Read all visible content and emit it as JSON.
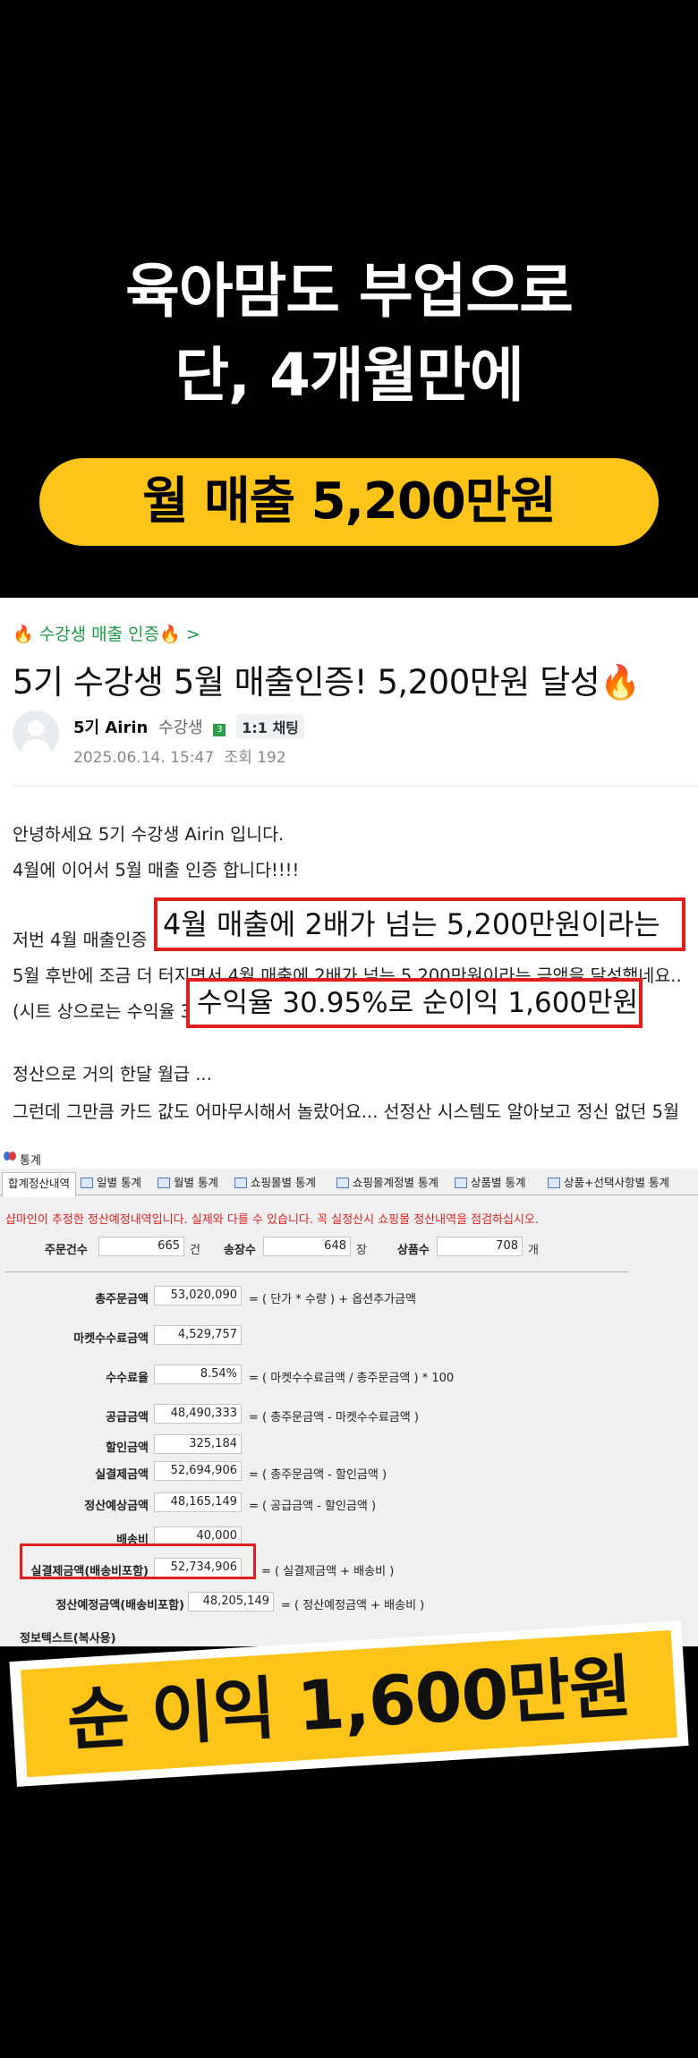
{
  "hero": {
    "line1": "육아맘도 부업으로",
    "line2": "단, 4개월만에",
    "highlight": "월 매출 5,200만원",
    "pill_color": "#fcc419"
  },
  "post": {
    "cafe_link": "🔥 수강생 매출 인증🔥 >",
    "title": "5기 수강생 5월 매출인증! 5,200만원 달성🔥",
    "author": "5기 Airin",
    "role": "수강생",
    "level": "3",
    "chat_label": "1:1 채팅",
    "date": "2025.06.14. 15:47",
    "views": "조회 192",
    "body": [
      "안녕하세요 5기 수강생 Airin 입니다.",
      "4월에 이어서 5월 매출 인증 합니다!!!!",
      "저번 4월 매출인증",
      "5월 후반에 조금 더 터지면서 4월 매출에 2배가 넘는 5,200만원이라는 금액을 달성했네요..",
      "(시트 상으로는 수익율 30.95%로 순이익 1,600만원 정도 입니다)",
      "정산으로 거의 한달 월급 ...",
      "그런데 그만큼 카드 값도 어마무시해서 놀랐어요... 선정산 시스템도 알아보고 정신 없던 5월"
    ],
    "callout1": "4월 매출에 2배가 넘는 5,200만원이라는",
    "callout2": "수익율 30.95%로 순이익 1,600만원",
    "accent_green": "#1a9b44",
    "callout_color": "#e01e1e"
  },
  "window": {
    "title": "통계",
    "tabs": [
      {
        "label": "합계정산내역",
        "active": true
      },
      {
        "label": "일별 통계"
      },
      {
        "label": "월별 통계"
      },
      {
        "label": "쇼핑몰별 통계"
      },
      {
        "label": "쇼핑몰계정별 통계"
      },
      {
        "label": "상품별 통계"
      },
      {
        "label": "상품+선택사항별 통계"
      }
    ],
    "warning": "샵마인이 추정한 정산예정내역입니다. 실제와 다를 수 있습니다. 꼭 실정산시 쇼핑몰 정산내역을 점검하십시오.",
    "summary": {
      "orders_label": "주문건수",
      "orders_value": "665",
      "orders_unit": "건",
      "invoices_label": "송장수",
      "invoices_value": "648",
      "invoices_unit": "장",
      "products_label": "상품수",
      "products_value": "708",
      "products_unit": "개"
    },
    "rows": [
      {
        "label": "총주문금액",
        "value": "53,020,090",
        "formula": "= ( 단가   *   수량 )  +  옵션추가금액"
      },
      {
        "label": "마켓수수료금액",
        "value": "4,529,757",
        "formula": ""
      },
      {
        "label": "수수료율",
        "value": "8.54%",
        "formula": "= ( 마켓수수료금액   /   총주문금액 ) * 100"
      },
      {
        "label": "공급금액",
        "value": "48,490,333",
        "formula": "= ( 총주문금액   -   마켓수수료금액 )"
      },
      {
        "label": "할인금액",
        "value": "325,184",
        "formula": ""
      },
      {
        "label": "실결제금액",
        "value": "52,694,906",
        "formula": "= ( 총주문금액   -   할인금액 )"
      },
      {
        "label": "정산예상금액",
        "value": "48,165,149",
        "formula": "= ( 공급금액   -   할인금액 )"
      },
      {
        "label": "배송비",
        "value": "40,000",
        "formula": ""
      },
      {
        "label": "실결제금액(배송비포함)",
        "value": "52,734,906",
        "formula": "= (   실결제금액    +   배송비 )"
      },
      {
        "label": "정산예정금액(배송비포함)",
        "value": "48,205,149",
        "formula": "= ( 정산예정금액   +   배송비 )"
      }
    ],
    "footer_label": "정보텍스트(복사용)"
  },
  "banner": {
    "text": "순 이익 1,600만원",
    "color": "#fcc419"
  }
}
